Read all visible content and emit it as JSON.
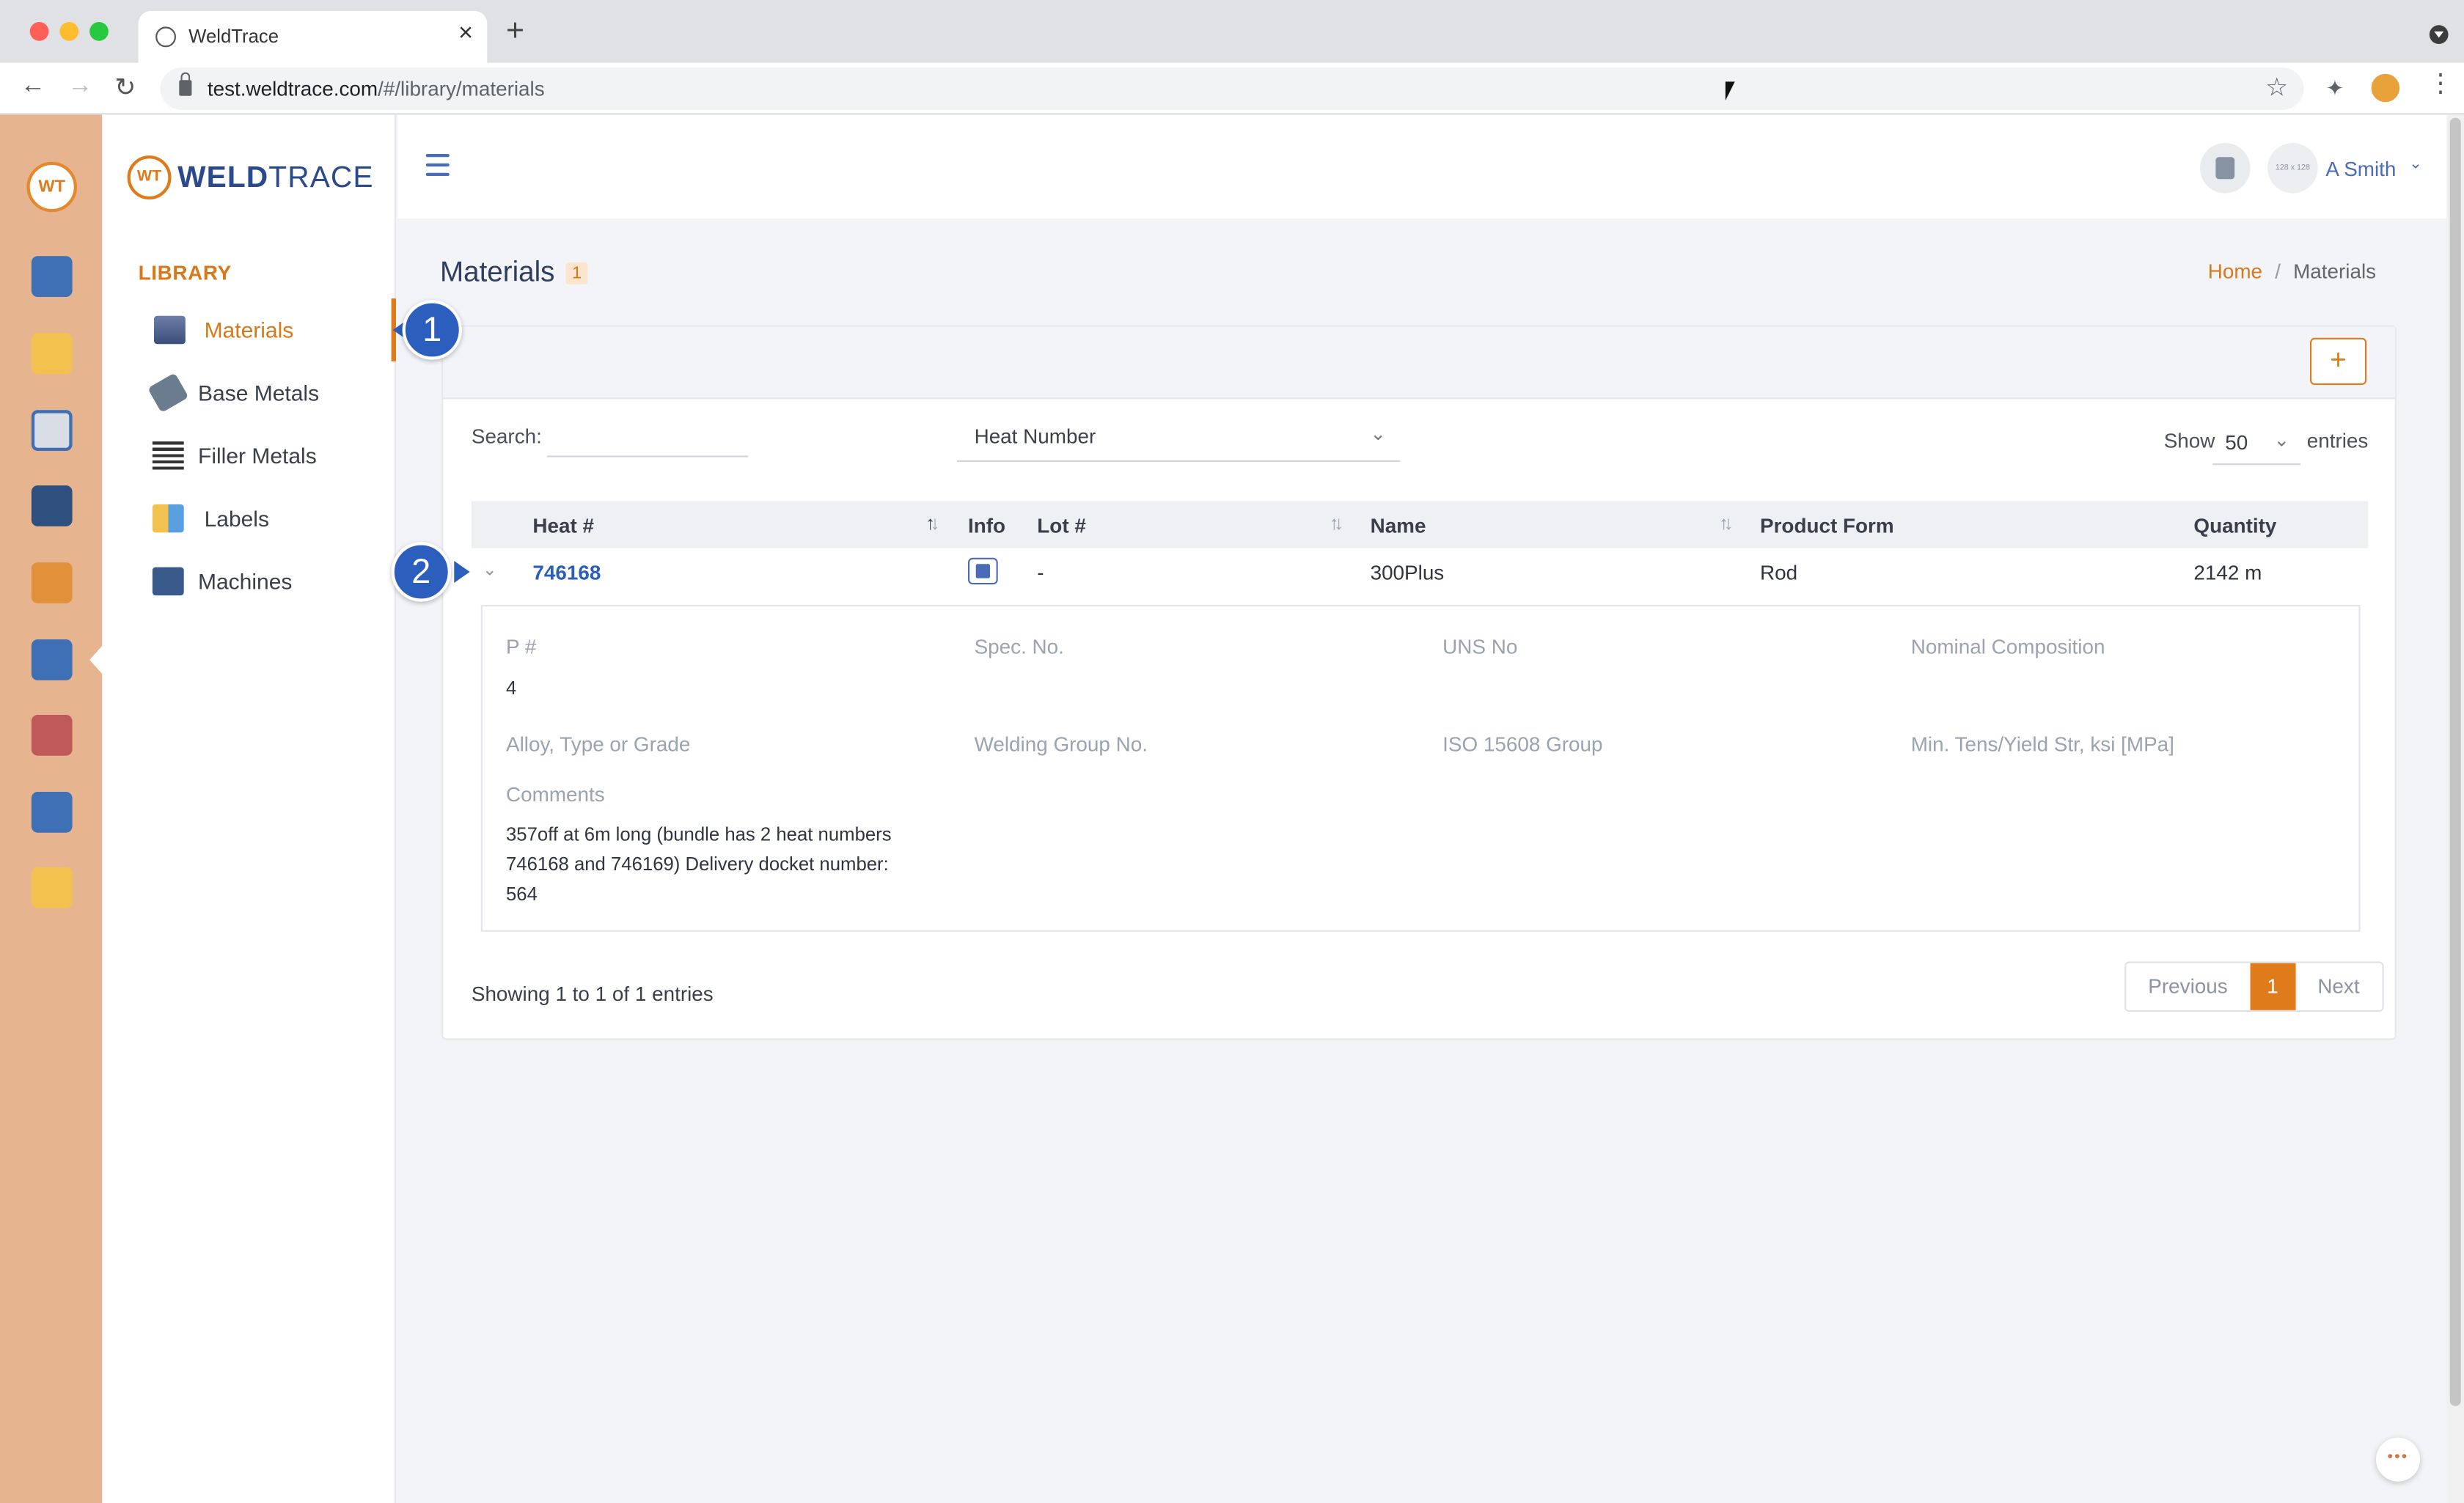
{
  "browser": {
    "tab_title": "WeldTrace",
    "url_host": "test.weldtrace.com",
    "url_path": "/#/library/materials"
  },
  "colors": {
    "accent": "#e07b1c",
    "link": "#2a5fb8",
    "iconbar": "#e6b48f",
    "callout": "#2c5fbd"
  },
  "brand": {
    "prefix": "WELD",
    "suffix": "TRACE",
    "mark": "WT"
  },
  "sidebar": {
    "section": "LIBRARY",
    "items": [
      {
        "label": "Materials",
        "icon": "materials-icon",
        "active": true
      },
      {
        "label": "Base Metals",
        "icon": "base-metals-icon"
      },
      {
        "label": "Filler Metals",
        "icon": "filler-metals-icon"
      },
      {
        "label": "Labels",
        "icon": "labels-icon"
      },
      {
        "label": "Machines",
        "icon": "machines-icon"
      }
    ]
  },
  "iconbar": [
    "monitor-icon",
    "folder-gear-icon",
    "clipboard-gear-icon",
    "welder-icon",
    "org-chart-icon",
    "library-icon",
    "team-icon",
    "report-icon",
    "badge-icon"
  ],
  "user": {
    "name": "A Smith",
    "avatar_placeholder": "128 x 128"
  },
  "page": {
    "title": "Materials",
    "count": "1"
  },
  "breadcrumb": {
    "home": "Home",
    "current": "Materials"
  },
  "toolbar": {
    "add_label": "+"
  },
  "filters": {
    "search_label": "Search:",
    "search_value": "",
    "field_select": "Heat Number",
    "show_label": "Show",
    "page_size": "50",
    "entries_label": "entries"
  },
  "table": {
    "columns": [
      "Heat #",
      "Info",
      "Lot #",
      "Name",
      "Product Form",
      "Quantity"
    ],
    "rows": [
      {
        "heat": "746168",
        "lot": "-",
        "name": "300Plus",
        "product_form": "Rod",
        "quantity": "2142 m"
      }
    ]
  },
  "detail": {
    "p_label": "P #",
    "p_value": "4",
    "spec_label": "Spec. No.",
    "uns_label": "UNS No",
    "composition_label": "Nominal Composition",
    "alloy_label": "Alloy, Type or Grade",
    "welding_group_label": "Welding Group No.",
    "iso_label": "ISO 15608 Group",
    "tens_label": "Min. Tens/Yield Str, ksi [MPa]",
    "comments_label": "Comments",
    "comments_line1": "357off at 6m long (bundle has 2 heat numbers",
    "comments_line2": "746168 and 746169) Delivery docket number:",
    "comments_line3": "564"
  },
  "footer": {
    "showing": "Showing 1 to 1 of 1 entries"
  },
  "pagination": {
    "previous": "Previous",
    "current": "1",
    "next": "Next"
  },
  "callouts": {
    "one": "1",
    "two": "2"
  }
}
